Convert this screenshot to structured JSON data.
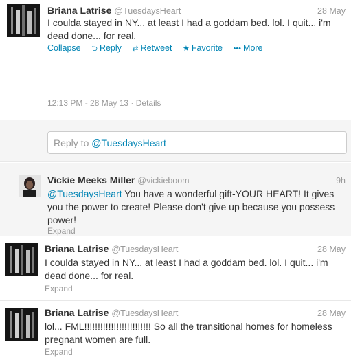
{
  "tweet1": {
    "name": "Briana Latrise",
    "handle": "@TuesdaysHeart",
    "time": "28 May",
    "text": "I coulda stayed in NY... at least I had a goddam bed. lol. I quit... i'm dead done... for real.",
    "actions": {
      "collapse": "Collapse",
      "reply": "Reply",
      "retweet": "Retweet",
      "favorite": "Favorite",
      "more": "More"
    },
    "meta": "12:13 PM - 28 May 13 · Details"
  },
  "reply_box": {
    "prefix": "Reply to ",
    "mention": "@TuesdaysHeart"
  },
  "tweet2": {
    "name": "Vickie Meeks Miller",
    "handle": "@vickieboom",
    "time": "9h",
    "mention": "@TuesdaysHeart",
    "text": " You have a wonderful gift-YOUR HEART! It gives you the power to create!  Please don't give up because you possess power!",
    "expand": "Expand"
  },
  "tweet3": {
    "name": "Briana Latrise",
    "handle": "@TuesdaysHeart",
    "time": "28 May",
    "text": "I coulda stayed in NY... at least I had a goddam bed. lol. I quit... i'm dead done... for real.",
    "expand": "Expand"
  },
  "tweet4": {
    "name": "Briana Latrise",
    "handle": "@TuesdaysHeart",
    "time": "28 May",
    "text": "lol... FML!!!!!!!!!!!!!!!!!!!!!!!!! So all the transitional homes for homeless pregnant women are full.",
    "expand": "Expand"
  },
  "icons": {
    "reply": "reply-arrow-icon",
    "retweet": "retweet-icon",
    "favorite": "star-icon",
    "more": "dots-icon"
  },
  "colors": {
    "link": "#0084b4",
    "muted": "#999999",
    "text": "#333333",
    "panel": "#f5f5f5"
  }
}
